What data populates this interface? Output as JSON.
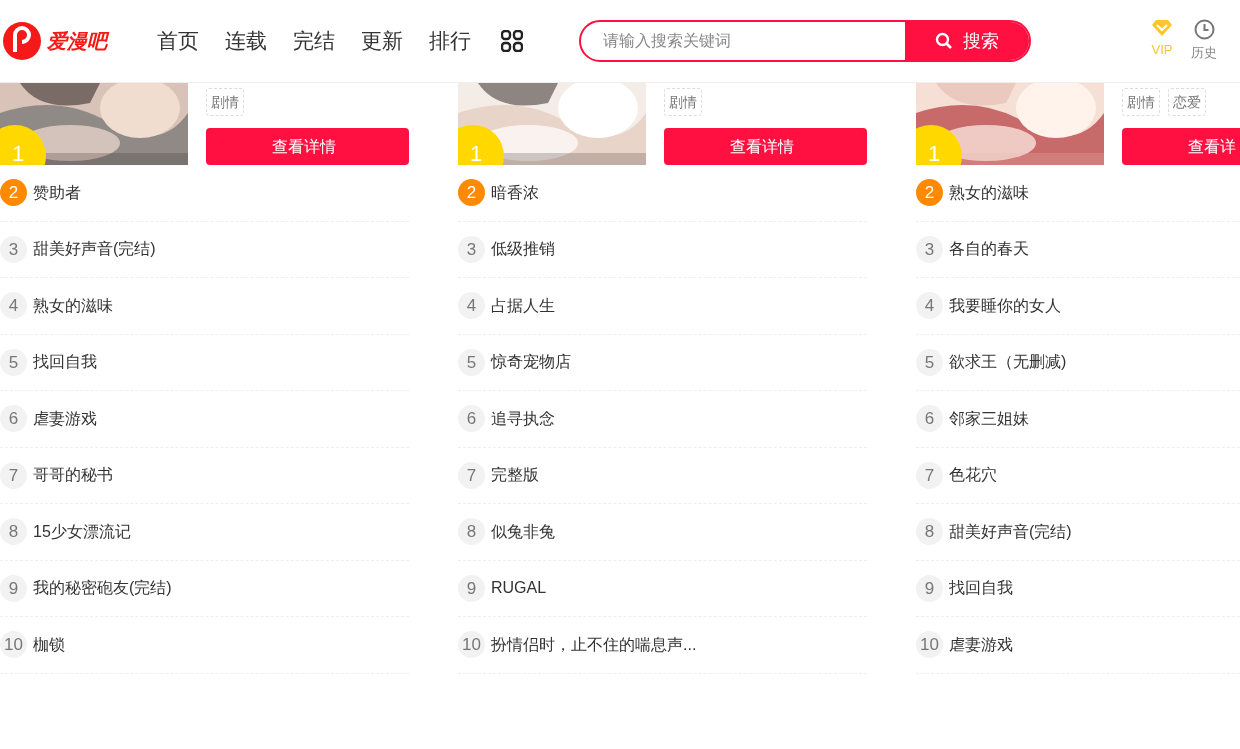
{
  "header": {
    "logo_text": "爱漫吧",
    "nav": [
      {
        "label": "首页"
      },
      {
        "label": "连载"
      },
      {
        "label": "完结"
      },
      {
        "label": "更新"
      },
      {
        "label": "排行"
      }
    ],
    "search": {
      "placeholder": "请输入搜索关键词",
      "button": "搜索"
    },
    "actions": [
      {
        "kind": "vip",
        "label": "VIP"
      },
      {
        "kind": "history",
        "label": "历史"
      }
    ]
  },
  "columns": [
    {
      "top": {
        "rank": "1",
        "color": "#ffd800",
        "tags": [
          "剧情"
        ],
        "button": "查看详情"
      },
      "items": [
        {
          "rank": "2",
          "title": "赞助者",
          "color": "#ff8a00"
        },
        {
          "rank": "3",
          "title": "甜美好声音(完结)",
          "color": "#f2f2f2"
        },
        {
          "rank": "4",
          "title": "熟女的滋味",
          "color": "#f2f2f2"
        },
        {
          "rank": "5",
          "title": "找回自我",
          "color": "#f2f2f2"
        },
        {
          "rank": "6",
          "title": "虐妻游戏",
          "color": "#f2f2f2"
        },
        {
          "rank": "7",
          "title": "哥哥的秘书",
          "color": "#f2f2f2"
        },
        {
          "rank": "8",
          "title": "15少女漂流记",
          "color": "#f2f2f2"
        },
        {
          "rank": "9",
          "title": "我的秘密砲友(完结)",
          "color": "#f2f2f2"
        },
        {
          "rank": "10",
          "title": "枷锁",
          "color": "#f2f2f2"
        }
      ]
    },
    {
      "top": {
        "rank": "1",
        "color": "#ffd800",
        "tags": [
          "剧情"
        ],
        "button": "查看详情"
      },
      "items": [
        {
          "rank": "2",
          "title": "暗香浓",
          "color": "#ff8a00"
        },
        {
          "rank": "3",
          "title": "低级推销",
          "color": "#f2f2f2"
        },
        {
          "rank": "4",
          "title": "占据人生",
          "color": "#f2f2f2"
        },
        {
          "rank": "5",
          "title": "惊奇宠物店",
          "color": "#f2f2f2"
        },
        {
          "rank": "6",
          "title": "追寻执念",
          "color": "#f2f2f2"
        },
        {
          "rank": "7",
          "title": "完整版",
          "color": "#f2f2f2"
        },
        {
          "rank": "8",
          "title": "似兔非兔",
          "color": "#f2f2f2"
        },
        {
          "rank": "9",
          "title": "RUGAL",
          "color": "#f2f2f2"
        },
        {
          "rank": "10",
          "title": "扮情侣时，止不住的喘息声...",
          "color": "#f2f2f2"
        }
      ]
    },
    {
      "top": {
        "rank": "1",
        "color": "#ffd800",
        "tags": [
          "剧情",
          "恋爱"
        ],
        "button": "查看详"
      },
      "items": [
        {
          "rank": "2",
          "title": "熟女的滋味",
          "color": "#ff8a00"
        },
        {
          "rank": "3",
          "title": "各自的春天",
          "color": "#f2f2f2"
        },
        {
          "rank": "4",
          "title": "我要睡你的女人",
          "color": "#f2f2f2"
        },
        {
          "rank": "5",
          "title": "欲求王（无删减)",
          "color": "#f2f2f2"
        },
        {
          "rank": "6",
          "title": "邻家三姐妹",
          "color": "#f2f2f2"
        },
        {
          "rank": "7",
          "title": "色花穴",
          "color": "#f2f2f2"
        },
        {
          "rank": "8",
          "title": "甜美好声音(完结)",
          "color": "#f2f2f2"
        },
        {
          "rank": "9",
          "title": "找回自我",
          "color": "#f2f2f2"
        },
        {
          "rank": "10",
          "title": "虐妻游戏",
          "color": "#f2f2f2"
        }
      ]
    }
  ]
}
